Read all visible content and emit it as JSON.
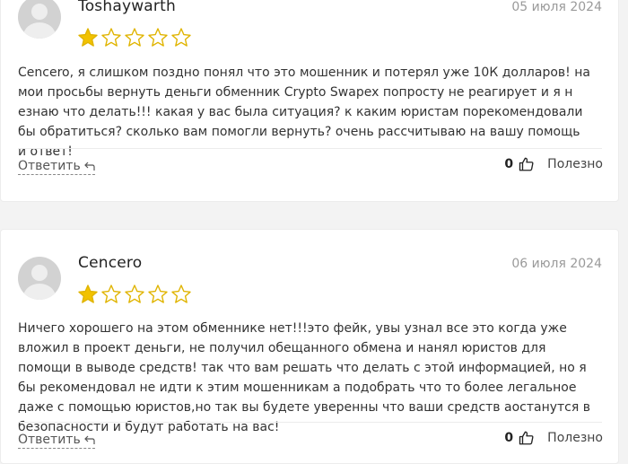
{
  "reviews": [
    {
      "author": "Toshaywarth",
      "date": "05 июля 2024",
      "rating": 1,
      "max_rating": 5,
      "text": "Cencero, я слишком поздно понял что это мошенник и потерял уже 10К долларов! на мои просьбы вернуть деньги обменник Crypto Swapex попросту не реагирует и я н езнаю что делать!!! какая у вас была ситуация? к каким юристам порекомендовали бы обратиться? сколько вам помогли вернуть? очень рассчитываю на вашу помощь и ответ!",
      "reply_label": "Ответить",
      "like_count": "0",
      "useful_label": "Полезно"
    },
    {
      "author": "Cencero",
      "date": "06 июля 2024",
      "rating": 1,
      "max_rating": 5,
      "text": "Ничего хорошего на этом обменнике нет!!!это фейк, увы узнал все это когда уже вложил в проект деньги, не получил обещанного обмена и нанял юристов для помощи в выводе средств! так что вам решать что делать с этой информацией, но я бы рекомендовал не идти к этим мошенникам а подобрать что то более легальное даже с помощью юристов,но так вы будете уверенны что ваши средств аостанутся в безопасности и будут работать на вас!",
      "reply_label": "Ответить",
      "like_count": "0",
      "useful_label": "Полезно"
    }
  ],
  "colors": {
    "star_fill": "#f2c200",
    "star_outline": "#e0b400",
    "card_bg": "#ffffff",
    "page_bg": "#f3f3f3"
  },
  "icons": {
    "star": "star-icon",
    "reply": "reply-arrow-icon",
    "like": "thumbs-up-icon",
    "avatar": "default-user-avatar"
  }
}
